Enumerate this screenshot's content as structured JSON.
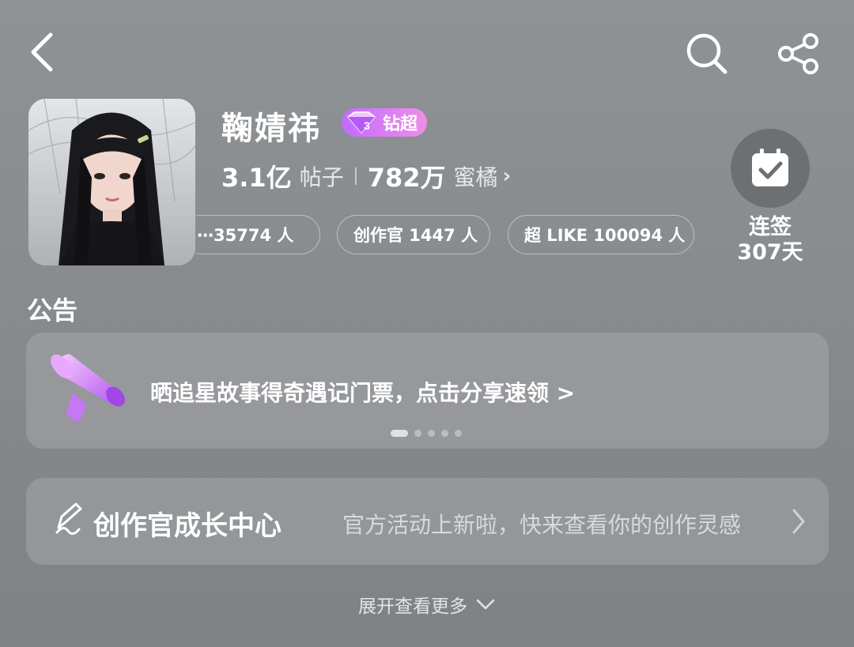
{
  "header": {
    "back_icon": "chevron-left-icon",
    "search_icon": "search-icon",
    "share_icon": "share-icon"
  },
  "profile": {
    "name": "鞠婧祎",
    "badge_label": "钻超",
    "badge_level": "3",
    "posts_count": "3.1亿",
    "posts_label": "帖子",
    "fans_count": "782万",
    "fans_label": "蜜橘",
    "chips": [
      "⋯35774 人",
      "创作官 1447 人",
      "超 LIKE 100094 人"
    ]
  },
  "checkin": {
    "label_line1": "连签",
    "label_line2": "307天",
    "icon": "calendar-check-icon"
  },
  "notice": {
    "title": "公告",
    "text": "晒追星故事得奇遇记门票，点击分享速领 >",
    "icon": "megaphone-icon",
    "page_count": 5,
    "active_index": 0
  },
  "creator_center": {
    "title": "创作官成长中心",
    "subtitle": "官方活动上新啦，快来查看你的创作灵感",
    "icon": "pen-signature-icon"
  },
  "footer": {
    "expand_label": "展开查看更多",
    "expand_icon": "chevron-down-icon"
  },
  "colors": {
    "badge_start": "#c26bff",
    "badge_end": "#f08de8",
    "megaphone": "#d98bff"
  }
}
